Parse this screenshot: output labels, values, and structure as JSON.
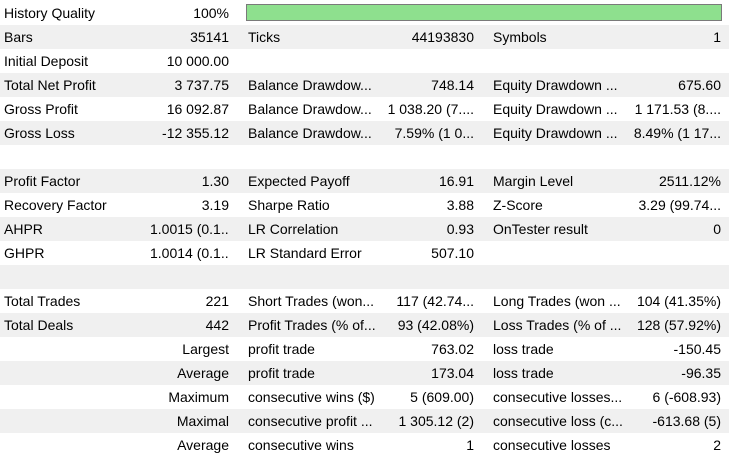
{
  "quality": {
    "label": "History Quality",
    "value": "100%",
    "fraction": 1.0,
    "bar_color": "#8ee08e"
  },
  "rows1": [
    {
      "c0": "Bars",
      "c1": "35141",
      "c2": "Ticks",
      "c3": "44193830",
      "c4": "Symbols",
      "c5": "1"
    },
    {
      "c0": "Initial Deposit",
      "c1": "10 000.00",
      "c2": "",
      "c3": "",
      "c4": "",
      "c5": ""
    },
    {
      "c0": "Total Net Profit",
      "c1": "3 737.75",
      "c2": "Balance Drawdow...",
      "c3": "748.14",
      "c4": "Equity Drawdown ...",
      "c5": "675.60"
    },
    {
      "c0": "Gross Profit",
      "c1": "16 092.87",
      "c2": "Balance Drawdow...",
      "c3": "1 038.20 (7....",
      "c4": "Equity Drawdown ...",
      "c5": "1 171.53 (8...."
    },
    {
      "c0": "Gross Loss",
      "c1": "-12 355.12",
      "c2": "Balance Drawdow...",
      "c3": "7.59% (1 0...",
      "c4": "Equity Drawdown ...",
      "c5": "8.49% (1 17..."
    }
  ],
  "rows2": [
    {
      "c0": "Profit Factor",
      "c1": "1.30",
      "c2": "Expected Payoff",
      "c3": "16.91",
      "c4": "Margin Level",
      "c5": "2511.12%"
    },
    {
      "c0": "Recovery Factor",
      "c1": "3.19",
      "c2": "Sharpe Ratio",
      "c3": "3.88",
      "c4": "Z-Score",
      "c5": "3.29 (99.74..."
    },
    {
      "c0": "AHPR",
      "c1": "1.0015 (0.1...",
      "c2": "LR Correlation",
      "c3": "0.93",
      "c4": "OnTester result",
      "c5": "0"
    },
    {
      "c0": "GHPR",
      "c1": "1.0014 (0.1...",
      "c2": "LR Standard Error",
      "c3": "507.10",
      "c4": "",
      "c5": ""
    }
  ],
  "rows3": [
    {
      "c0": "Total Trades",
      "c1": "221",
      "c2": "Short Trades (won...",
      "c3": "117 (42.74...",
      "c4": "Long Trades (won ...",
      "c5": "104 (41.35%)"
    },
    {
      "c0": "Total Deals",
      "c1": "442",
      "c2": "Profit Trades (% of...",
      "c3": "93 (42.08%)",
      "c4": "Loss Trades (% of ...",
      "c5": "128 (57.92%)"
    }
  ],
  "rows4": [
    {
      "c0": "Largest",
      "c2": "profit trade",
      "c3": "763.02",
      "c4": "loss trade",
      "c5": "-150.45"
    },
    {
      "c0": "Average",
      "c2": "profit trade",
      "c3": "173.04",
      "c4": "loss trade",
      "c5": "-96.35"
    },
    {
      "c0": "Maximum",
      "c2": "consecutive wins ($)",
      "c3": "5 (609.00)",
      "c4": "consecutive losses...",
      "c5": "6 (-608.93)"
    },
    {
      "c0": "Maximal",
      "c2": "consecutive profit ...",
      "c3": "1 305.12 (2)",
      "c4": "consecutive loss (c...",
      "c5": "-613.68 (5)"
    },
    {
      "c0": "Average",
      "c2": "consecutive wins",
      "c3": "1",
      "c4": "consecutive losses",
      "c5": "2"
    }
  ]
}
